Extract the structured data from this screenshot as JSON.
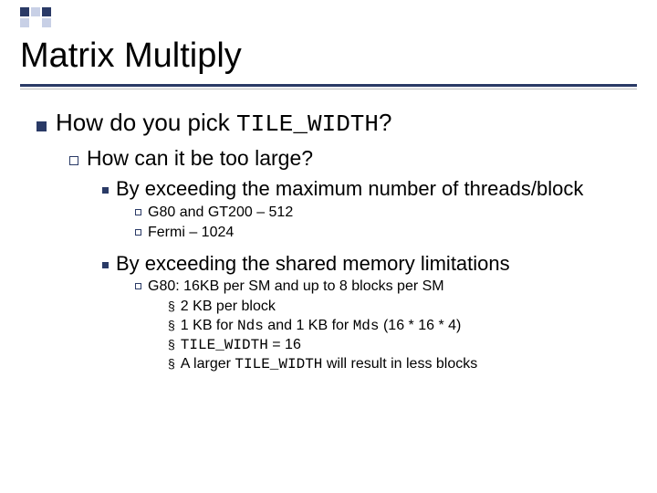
{
  "title": "Matrix Multiply",
  "lvl1": {
    "text_pre": "How do you pick ",
    "code": "TILE_WIDTH",
    "text_post": "?"
  },
  "lvl2": {
    "text": "How can it be too large?"
  },
  "lvl3a": {
    "text": "By exceeding the maximum number of threads/block"
  },
  "lvl4a": {
    "text": "G80 and GT200 – 512"
  },
  "lvl4b": {
    "text": "Fermi – 1024"
  },
  "lvl3b": {
    "text": "By exceeding the shared memory limitations"
  },
  "lvl4c": {
    "text": "G80:  16KB per SM and up to 8 blocks per SM"
  },
  "lvl5a": {
    "text": "2 KB per block"
  },
  "lvl5b": {
    "pre1": "1 KB for ",
    "code1": "Nds",
    "mid": " and 1 KB for ",
    "code2": "Mds",
    "post": "  (16 * 16 * 4)"
  },
  "lvl5c": {
    "code": "TILE_WIDTH",
    "post": "  = 16"
  },
  "lvl5d": {
    "pre": "A larger ",
    "code": "TILE_WIDTH",
    "post": " will result in less blocks"
  }
}
